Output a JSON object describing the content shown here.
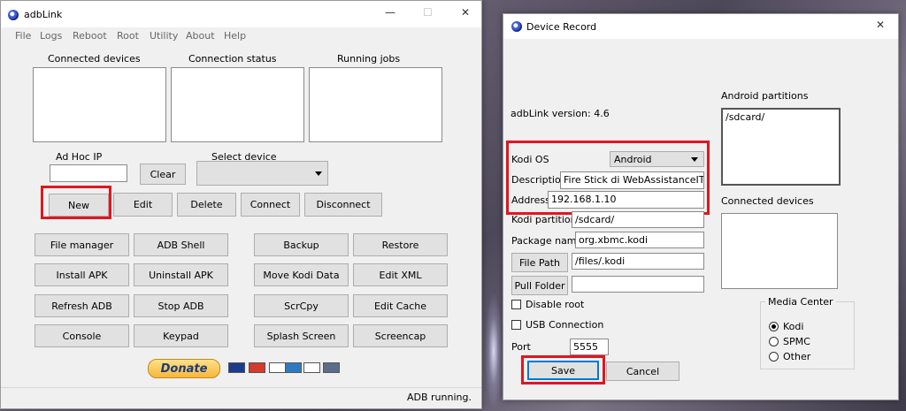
{
  "left": {
    "title": "adbLink",
    "menu": [
      "File",
      "Logs",
      "Reboot",
      "Root",
      "Utility",
      "About",
      "Help"
    ],
    "panels": {
      "connected_devices": "Connected devices",
      "connection_status": "Connection status",
      "running_jobs": "Running jobs"
    },
    "adhoc_label": "Ad Hoc IP",
    "adhoc_value": "",
    "clear": "Clear",
    "select_device_label": "Select device",
    "select_device_value": "",
    "device_buttons": [
      "New",
      "Edit",
      "Delete",
      "Connect",
      "Disconnect"
    ],
    "grid_left": [
      [
        "File manager",
        "ADB Shell"
      ],
      [
        "Install APK",
        "Uninstall APK"
      ],
      [
        "Refresh ADB",
        "Stop ADB"
      ],
      [
        "Console",
        "Keypad"
      ]
    ],
    "grid_right": [
      [
        "Backup",
        "Restore"
      ],
      [
        "Move Kodi Data",
        "Edit XML"
      ],
      [
        "ScrCpy",
        "Edit Cache"
      ],
      [
        "Splash Screen",
        "Screencap"
      ]
    ],
    "donate": "Donate",
    "status": "ADB running."
  },
  "right": {
    "title": "Device Record",
    "version": "adbLink version: 4.6",
    "kodi_os_label": "Kodi OS",
    "kodi_os_value": "Android",
    "description_label": "Description",
    "description_value": "Fire Stick di WebAssistanceITA",
    "address_label": "Address",
    "address_value": "192.168.1.10",
    "kodi_partition_label": "Kodi partition",
    "kodi_partition_value": "/sdcard/",
    "package_label": "Package name",
    "package_value": "org.xbmc.kodi",
    "file_path_button": "File Path",
    "file_path_value": "/files/.kodi",
    "pull_folder_button": "Pull Folder",
    "pull_folder_value": "",
    "disable_root": "Disable root",
    "usb_connection": "USB Connection",
    "port_label": "Port",
    "port_value": "5555",
    "save": "Save",
    "cancel": "Cancel",
    "android_partitions_label": "Android partitions",
    "android_partitions": [
      "/sdcard/"
    ],
    "connected_devices_label": "Connected devices",
    "media_center_label": "Media Center",
    "media_center_options": [
      "Kodi",
      "SPMC",
      "Other"
    ],
    "media_center_selected": "Kodi"
  },
  "colors": {
    "highlight": "#e0161f",
    "window": "#f0f0f0",
    "button": "#e1e1e1",
    "save_border": "#0078d7"
  }
}
